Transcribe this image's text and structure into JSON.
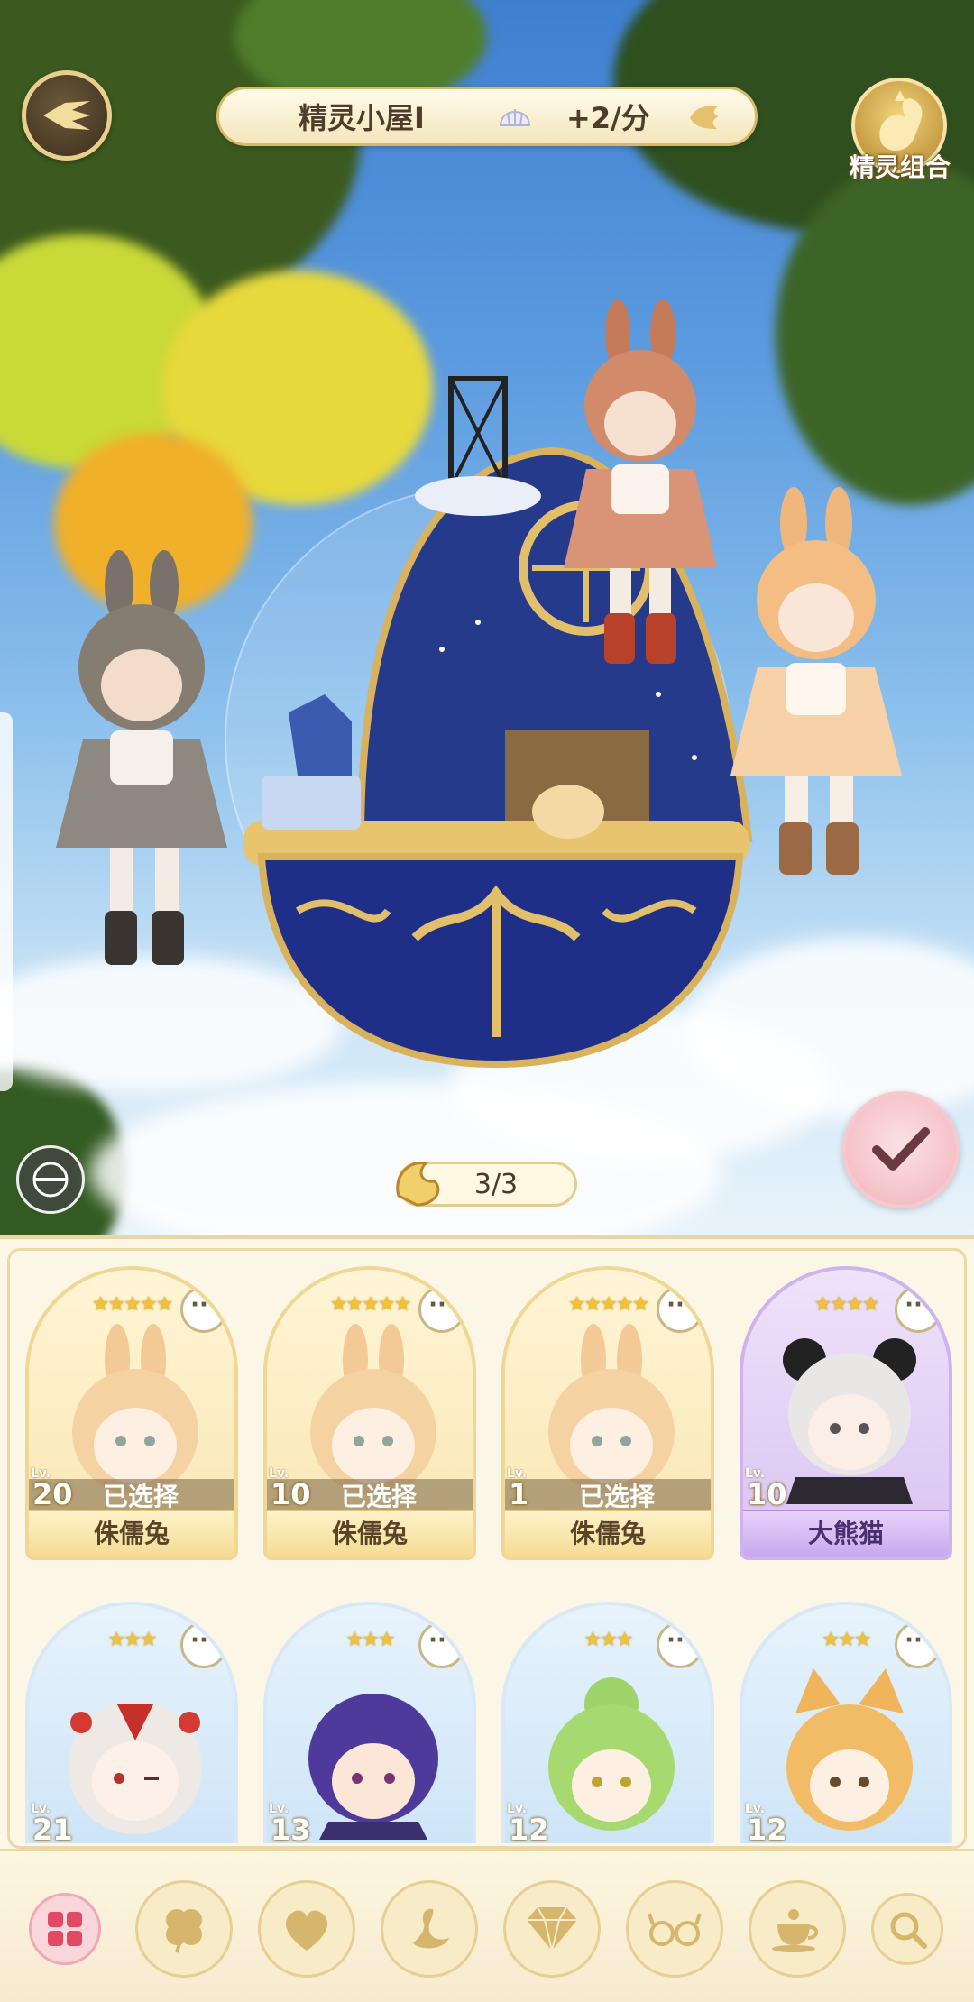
{
  "header": {
    "house_name": "精灵小屋Ⅰ",
    "income_rate": "+2/分",
    "combo_label": "精灵组合"
  },
  "scene": {
    "placement_counter": "3/3"
  },
  "icons": {
    "back": "winged-back-arrow-icon",
    "shell": "shell-icon",
    "wing": "wing-icon",
    "combo": "golden-swan-icon",
    "hide": "eye-hide-icon",
    "confirm": "checkmark-icon",
    "counter": "spirit-token-icon"
  },
  "spirit_cards": [
    {
      "stars": "★★★★★",
      "level_tag": "Lv.",
      "level": "20",
      "status": "已选择",
      "name": "侏儒兔",
      "theme": "gold"
    },
    {
      "stars": "★★★★★",
      "level_tag": "Lv.",
      "level": "10",
      "status": "已选择",
      "name": "侏儒兔",
      "theme": "gold"
    },
    {
      "stars": "★★★★★",
      "level_tag": "Lv.",
      "level": "1",
      "status": "已选择",
      "name": "侏儒兔",
      "theme": "gold"
    },
    {
      "stars": "★★★★",
      "level_tag": "Lv.",
      "level": "10",
      "status": "",
      "name": "大熊猫",
      "theme": "purple"
    },
    {
      "stars": "★★★",
      "level_tag": "Lv.",
      "level": "21",
      "status": "",
      "name": "",
      "theme": "blue"
    },
    {
      "stars": "★★★",
      "level_tag": "Lv.",
      "level": "13",
      "status": "",
      "name": "",
      "theme": "blue"
    },
    {
      "stars": "★★★",
      "level_tag": "Lv.",
      "level": "12",
      "status": "",
      "name": "",
      "theme": "blue"
    },
    {
      "stars": "★★★",
      "level_tag": "Lv.",
      "level": "12",
      "status": "",
      "name": "",
      "theme": "blue"
    }
  ],
  "more_button_label": "···",
  "filters": [
    {
      "icon": "grid-all-icon",
      "active": true
    },
    {
      "icon": "clover-icon",
      "active": false
    },
    {
      "icon": "heart-icon",
      "active": false
    },
    {
      "icon": "swan-icon",
      "active": false
    },
    {
      "icon": "diamond-icon",
      "active": false
    },
    {
      "icon": "glasses-icon",
      "active": false
    },
    {
      "icon": "teacup-icon",
      "active": false
    },
    {
      "icon": "search-icon",
      "active": false
    }
  ],
  "colors": {
    "gold_accent": "#e8cf8d",
    "panel_bg": "#fbf6e6",
    "confirm_pink": "#f2b3bb",
    "purple_card": "#cfb3ee"
  }
}
